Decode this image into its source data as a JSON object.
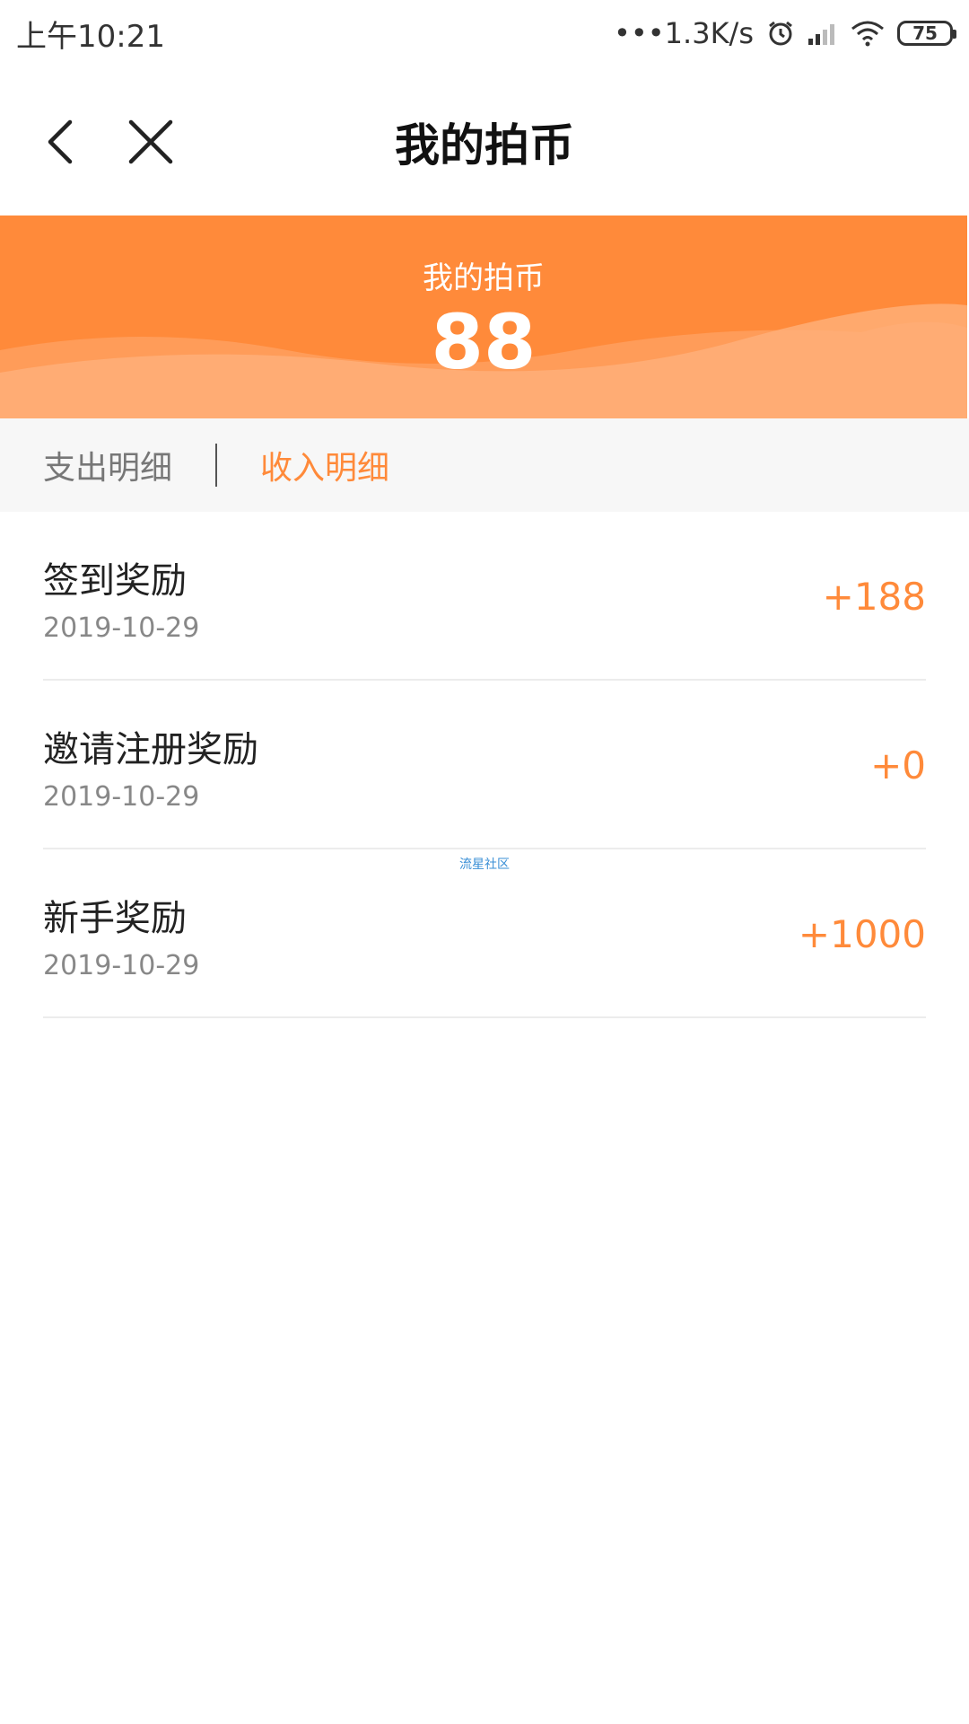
{
  "status_bar": {
    "time": "上午10:21",
    "network_speed": "•••1.3K/s",
    "battery": "75",
    "icons": [
      "alarm-icon",
      "signal-icon",
      "wifi-icon",
      "battery-icon"
    ]
  },
  "nav": {
    "title": "我的拍币",
    "back_icon": "chevron-left-icon",
    "close_icon": "close-icon"
  },
  "banner": {
    "label": "我的拍币",
    "value": "88"
  },
  "tabs": [
    {
      "label": "支出明细",
      "active": false
    },
    {
      "label": "收入明细",
      "active": true
    }
  ],
  "records": [
    {
      "title": "签到奖励",
      "date": "2019-10-29",
      "amount": "+188"
    },
    {
      "title": "邀请注册奖励",
      "date": "2019-10-29",
      "amount": "+0"
    },
    {
      "title": "新手奖励",
      "date": "2019-10-29",
      "amount": "+1000"
    }
  ],
  "watermark": "流星社区",
  "colors": {
    "accent": "#ff8a3a",
    "banner_light": "#ffb07a"
  }
}
